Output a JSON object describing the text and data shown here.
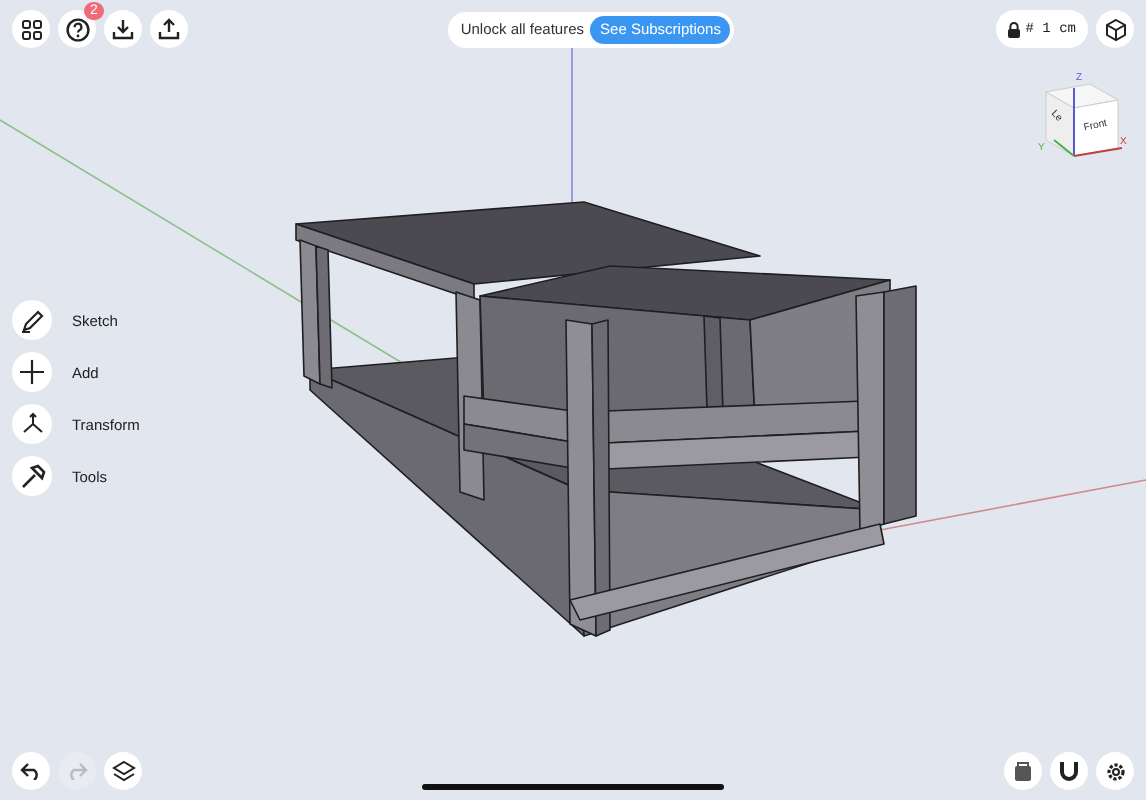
{
  "top_left_buttons": [
    {
      "kind": "grid"
    },
    {
      "kind": "help",
      "badge": "2"
    },
    {
      "kind": "import"
    },
    {
      "kind": "share"
    }
  ],
  "promo": {
    "text": "Unlock all features",
    "button": "See Subscriptions"
  },
  "units": {
    "label": "# 1 cm"
  },
  "view_cube": {
    "faces": [
      "Front",
      "Le"
    ],
    "axes": [
      "Z",
      "Y",
      "X"
    ]
  },
  "tools": [
    {
      "kind": "sketch",
      "label": "Sketch"
    },
    {
      "kind": "add",
      "label": "Add"
    },
    {
      "kind": "transform",
      "label": "Transform"
    },
    {
      "kind": "tools",
      "label": "Tools"
    }
  ],
  "bottom_left_buttons": [
    {
      "kind": "undo",
      "disabled": false
    },
    {
      "kind": "redo",
      "disabled": true
    },
    {
      "kind": "layers",
      "disabled": false
    }
  ],
  "bottom_right_buttons": [
    {
      "kind": "materials"
    },
    {
      "kind": "magnet"
    },
    {
      "kind": "settings"
    }
  ]
}
